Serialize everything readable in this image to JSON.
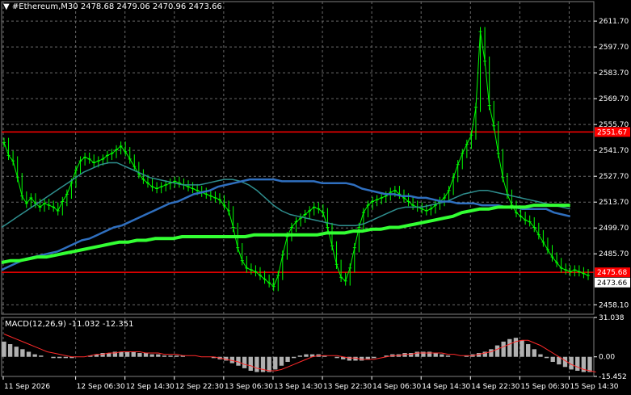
{
  "header": {
    "symbol_title": "#Ethereum,M30",
    "ohlc": "2478.68 2479.06 2470.96 2473.66"
  },
  "macd": {
    "title": "MACD(12,26,9) -11.032 -12.351",
    "axis_ticks": [
      "31.038",
      "0.00",
      "-15.452"
    ]
  },
  "price_axis": {
    "ticks": [
      "2611.70",
      "2597.70",
      "2583.70",
      "2569.70",
      "2555.70",
      "2541.70",
      "2527.70",
      "2513.70",
      "2499.70",
      "2485.70",
      "2458.10"
    ],
    "tag_resistance": "2551.67",
    "tag_support": "2475.68",
    "tag_current": "2473.66"
  },
  "time_axis": {
    "ticks": [
      "11 Sep 2026",
      "12 Sep 06:30",
      "12 Sep 14:30",
      "12 Sep 22:30",
      "13 Sep 06:30",
      "13 Sep 14:30",
      "13 Sep 22:30",
      "14 Sep 06:30",
      "14 Sep 14:30",
      "14 Sep 22:30",
      "15 Sep 06:30",
      "15 Sep 14:30"
    ]
  },
  "colors": {
    "candles": "#00ff00",
    "level_line": "#ff0000",
    "ma_fast": "#2f6fbf",
    "ma_teal": "#2f8f8f",
    "ma_slow": "#33ff33",
    "macd_hist": "#b0b0b0",
    "macd_signal": "#ff2a2a"
  },
  "chart_data": {
    "type": "line",
    "ylim": [
      2453,
      2617
    ],
    "levels": [
      2551.67,
      2475.68
    ],
    "price": [
      2546,
      2539,
      2536,
      2527,
      2517,
      2513,
      2516,
      2513,
      2511,
      2513,
      2512,
      2511,
      2509,
      2514,
      2518,
      2524,
      2531,
      2536,
      2538,
      2537,
      2535,
      2536,
      2537,
      2539,
      2540,
      2542,
      2544,
      2541,
      2537,
      2533,
      2529,
      2526,
      2524,
      2522,
      2521,
      2522,
      2523,
      2524,
      2525,
      2524,
      2523,
      2522,
      2521,
      2520,
      2519,
      2518,
      2517,
      2516,
      2515,
      2512,
      2509,
      2500,
      2489,
      2482,
      2478,
      2477,
      2476,
      2474,
      2472,
      2470,
      2468,
      2474,
      2485,
      2495,
      2500,
      2503,
      2505,
      2507,
      2509,
      2511,
      2510,
      2508,
      2500,
      2490,
      2480,
      2473,
      2471,
      2478,
      2489,
      2500,
      2508,
      2512,
      2514,
      2515,
      2516,
      2517,
      2519,
      2520,
      2518,
      2516,
      2514,
      2512,
      2511,
      2510,
      2509,
      2510,
      2512,
      2514,
      2516,
      2520,
      2527,
      2534,
      2540,
      2545,
      2550,
      2565,
      2606,
      2590,
      2566,
      2555,
      2540,
      2527,
      2518,
      2512,
      2508,
      2506,
      2504,
      2503,
      2500,
      2496,
      2492,
      2488,
      2484,
      2481,
      2478,
      2477,
      2476,
      2477,
      2476,
      2475,
      2474
    ],
    "ma_fast": [
      2477,
      2479,
      2481,
      2483,
      2484,
      2485,
      2486,
      2487,
      2489,
      2491,
      2493,
      2494,
      2496,
      2498,
      2500,
      2501,
      2503,
      2505,
      2507,
      2509,
      2511,
      2513,
      2514,
      2516,
      2518,
      2519,
      2520,
      2522,
      2523,
      2524,
      2525,
      2526,
      2526,
      2526,
      2526,
      2525,
      2525,
      2525,
      2525,
      2525,
      2524,
      2524,
      2524,
      2524,
      2523,
      2521,
      2520,
      2519,
      2518,
      2518,
      2517,
      2517,
      2516,
      2516,
      2515,
      2514,
      2514,
      2513,
      2513,
      2513,
      2512,
      2512,
      2512,
      2511,
      2511,
      2510,
      2510,
      2510,
      2510,
      2508,
      2507,
      2506
    ],
    "ma_teal": [
      2500,
      2503,
      2506,
      2509,
      2512,
      2515,
      2518,
      2521,
      2524,
      2527,
      2530,
      2532,
      2534,
      2535,
      2535,
      2533,
      2531,
      2529,
      2527,
      2526,
      2525,
      2524,
      2523,
      2523,
      2523,
      2524,
      2525,
      2526,
      2526,
      2525,
      2523,
      2520,
      2516,
      2512,
      2509,
      2507,
      2506,
      2505,
      2504,
      2503,
      2502,
      2501,
      2501,
      2501,
      2502,
      2504,
      2506,
      2508,
      2510,
      2511,
      2511,
      2511,
      2512,
      2513,
      2514,
      2516,
      2518,
      2519,
      2520,
      2520,
      2519,
      2518,
      2517,
      2516,
      2515,
      2514,
      2513,
      2512,
      2511,
      2510
    ],
    "ma_slow": [
      2481,
      2482,
      2482,
      2483,
      2484,
      2484,
      2485,
      2486,
      2487,
      2488,
      2489,
      2490,
      2491,
      2492,
      2492,
      2493,
      2493,
      2494,
      2494,
      2494,
      2495,
      2495,
      2495,
      2495,
      2495,
      2495,
      2495,
      2495,
      2496,
      2496,
      2496,
      2496,
      2496,
      2496,
      2496,
      2496,
      2497,
      2497,
      2497,
      2498,
      2498,
      2499,
      2499,
      2500,
      2500,
      2501,
      2502,
      2503,
      2504,
      2505,
      2506,
      2508,
      2509,
      2510,
      2510,
      2511,
      2511,
      2511,
      2511,
      2512,
      2512,
      2512,
      2512,
      2512
    ],
    "macd_ylim": [
      -15.452,
      31.038
    ],
    "macd_hist": [
      12,
      10,
      8,
      6,
      4,
      2,
      1,
      0,
      -1,
      -1,
      -1,
      -1,
      0,
      0,
      1,
      2,
      3,
      3,
      4,
      4,
      4,
      4,
      3,
      3,
      2,
      2,
      1,
      1,
      1,
      1,
      0,
      0,
      0,
      0,
      -1,
      -2,
      -3,
      -5,
      -7,
      -9,
      -11,
      -12,
      -12,
      -12,
      -10,
      -7,
      -4,
      -1,
      1,
      2,
      2,
      2,
      1,
      0,
      -1,
      -2,
      -3,
      -3,
      -3,
      -2,
      -1,
      0,
      1,
      2,
      2,
      3,
      3,
      4,
      4,
      4,
      3,
      2,
      1,
      0,
      0,
      1,
      2,
      3,
      4,
      6,
      9,
      12,
      14,
      15,
      13,
      10,
      6,
      2,
      -1,
      -4,
      -6,
      -8,
      -10,
      -11,
      -12,
      -12
    ],
    "macd_signal": [
      18,
      16,
      14,
      12,
      10,
      8,
      6,
      4,
      3,
      2,
      1,
      0,
      0,
      0,
      1,
      2,
      2,
      3,
      3,
      4,
      4,
      4,
      4,
      3,
      3,
      3,
      2,
      2,
      2,
      1,
      1,
      1,
      0,
      0,
      0,
      -1,
      -2,
      -3,
      -4,
      -6,
      -7,
      -9,
      -10,
      -11,
      -11,
      -10,
      -8,
      -6,
      -4,
      -2,
      0,
      1,
      1,
      1,
      1,
      0,
      -1,
      -1,
      -2,
      -2,
      -2,
      -1,
      0,
      1,
      1,
      2,
      2,
      3,
      3,
      3,
      3,
      3,
      2,
      2,
      1,
      1,
      1,
      2,
      3,
      4,
      6,
      8,
      10,
      12,
      13,
      13,
      11,
      9,
      6,
      3,
      0,
      -3,
      -6,
      -8,
      -10,
      -11,
      -12
    ]
  }
}
